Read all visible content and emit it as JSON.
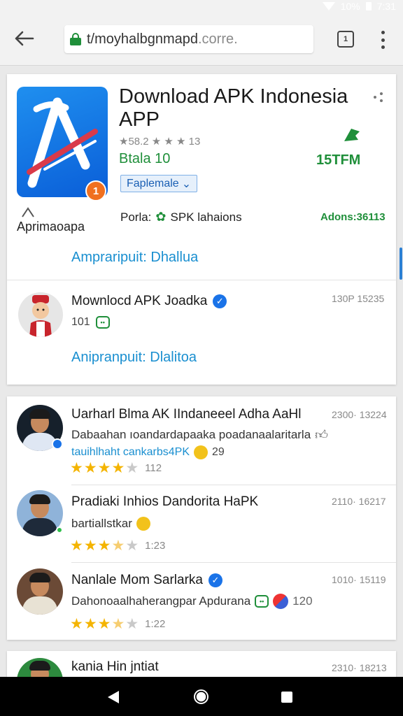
{
  "status_bar": {
    "battery": "10%",
    "time": "7:31"
  },
  "browser": {
    "url_main": "t/moyhalbgnmapd",
    "url_tld": ".corre.",
    "tabs_count": "1"
  },
  "app": {
    "title": "Download APK Indonesia APP",
    "rating_meta": "★58.2 ★ ★ ★ 13",
    "beta": "Btala 10",
    "size": "15TFM",
    "select_label": "Faplemale",
    "developer": "Aprimaoapa",
    "porla_label": "Porla:",
    "porla_value": "SPK lahaions",
    "adons": "Adons:36113",
    "link": "Ampraripuit: Dhallua",
    "badge": "1"
  },
  "download_item": {
    "title": "Mownlocd APK Joadka",
    "time": "130P 15235",
    "count": "101",
    "link": "Anipranpuit: Dlalitoa"
  },
  "reviews": [
    {
      "name": "Uarharl Blma AK IIndaneeel Adha AaHl",
      "time": "2300· 13224",
      "text": "Dabaahan ıoandardapaaka poadanaalaritarla",
      "text2": "tauihlhaht cankarbs4PK",
      "text2_num": "29",
      "rating": 4,
      "count": "112"
    },
    {
      "name": "Pradiaki Inhios Dandorita HaPK",
      "time": "2110· 16217",
      "text": "bartiallstkar",
      "rating": 3.5,
      "count": "1:23"
    },
    {
      "name": "Nanlale Mom Sarlarka",
      "time": "1010· 15119",
      "text": "Dahonoaalhaherangpar Apdurana",
      "text_num": "120",
      "rating": 3.5,
      "count": "1:22"
    },
    {
      "name": "kania Hin jntiat",
      "time": "2310· 18213"
    }
  ],
  "colors": {
    "accent_blue": "#1a8fd0",
    "green": "#1f8f3a",
    "star": "#f4b400"
  }
}
